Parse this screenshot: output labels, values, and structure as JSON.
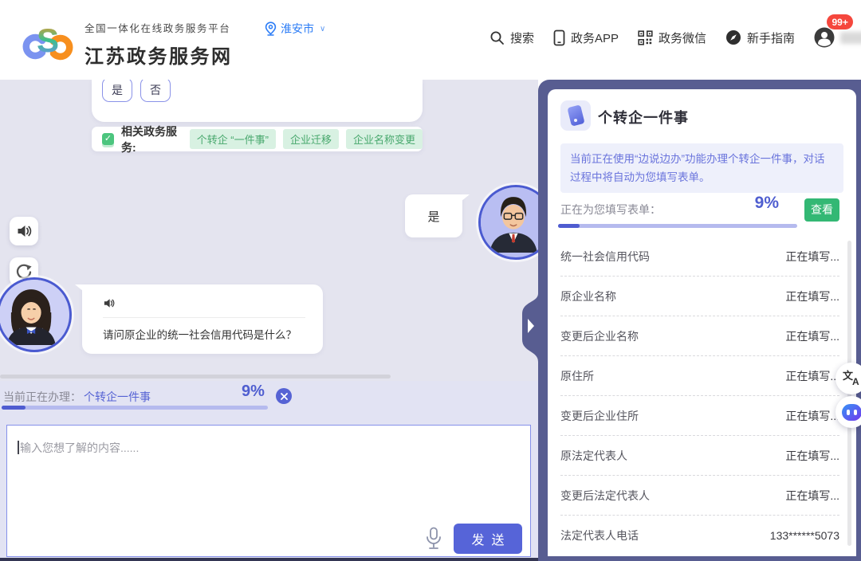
{
  "header": {
    "platform_subtitle": "全国一体化在线政务服务平台",
    "site_title": "江苏政务服务网",
    "location": {
      "city": "淮安市",
      "chevron": "∨"
    },
    "nav": {
      "search": "搜索",
      "app": "政务APP",
      "wechat": "政务微信",
      "guide": "新手指南",
      "badge": "99+"
    }
  },
  "chat": {
    "quick_replies": [
      "是",
      "否"
    ],
    "related_services": {
      "label": "相关政务服务:",
      "tags": [
        "个转企 “一件事”",
        "企业迁移",
        "企业名称变更"
      ]
    },
    "user_message": "是",
    "assistant_message": "请问原企业的统一社会信用代码是什么？",
    "processing": {
      "label": "当前正在办理：",
      "task": "个转企一件事",
      "percent": "9%"
    },
    "input": {
      "placeholder": "输入您想了解的内容......",
      "send_label": "发送"
    }
  },
  "panel": {
    "title": "个转企一件事",
    "notice": "当前正在使用“边说边办”功能办理个转企一件事，对话过程中将自动为您填写表单。",
    "form_progress": {
      "label": "正在为您填写表单：",
      "percent": "9%",
      "view_button": "查看"
    },
    "fields": [
      {
        "label": "统一社会信用代码",
        "value": "正在填写..."
      },
      {
        "label": "原企业名称",
        "value": "正在填写..."
      },
      {
        "label": "变更后企业名称",
        "value": "正在填写..."
      },
      {
        "label": "原住所",
        "value": "正在填写..."
      },
      {
        "label": "变更后企业住所",
        "value": "正在填写..."
      },
      {
        "label": "原法定代表人",
        "value": "正在填写..."
      },
      {
        "label": "变更后法定代表人",
        "value": "正在填写..."
      },
      {
        "label": "法定代表人电话",
        "value": "133******5073"
      }
    ]
  },
  "icons": {
    "logo-icon": "cloud-S logo",
    "location-pin-icon": "map pin",
    "search-icon": "magnifier",
    "phone-icon": "smartphone",
    "qr-code-icon": "qr code",
    "compass-icon": "compass",
    "avatar-icon": "person",
    "speaker-icon": "speaker",
    "refresh-icon": "circular arrow",
    "check-icon": "checkmark",
    "close-icon": "x in circle",
    "mic-icon": "microphone",
    "panel-collapse-icon": "right triangle",
    "translate-icon": "文/A translate",
    "robot-icon": "chat robot"
  },
  "colors": {
    "accent_purple": "#5663d4",
    "panel_bg": "#585d91",
    "link_blue": "#2b7cf6",
    "green": "#33b874",
    "tag_green_bg": "#d8f1e2",
    "badge_red": "#f5473d",
    "chat_bg": "#e4e4ef"
  }
}
